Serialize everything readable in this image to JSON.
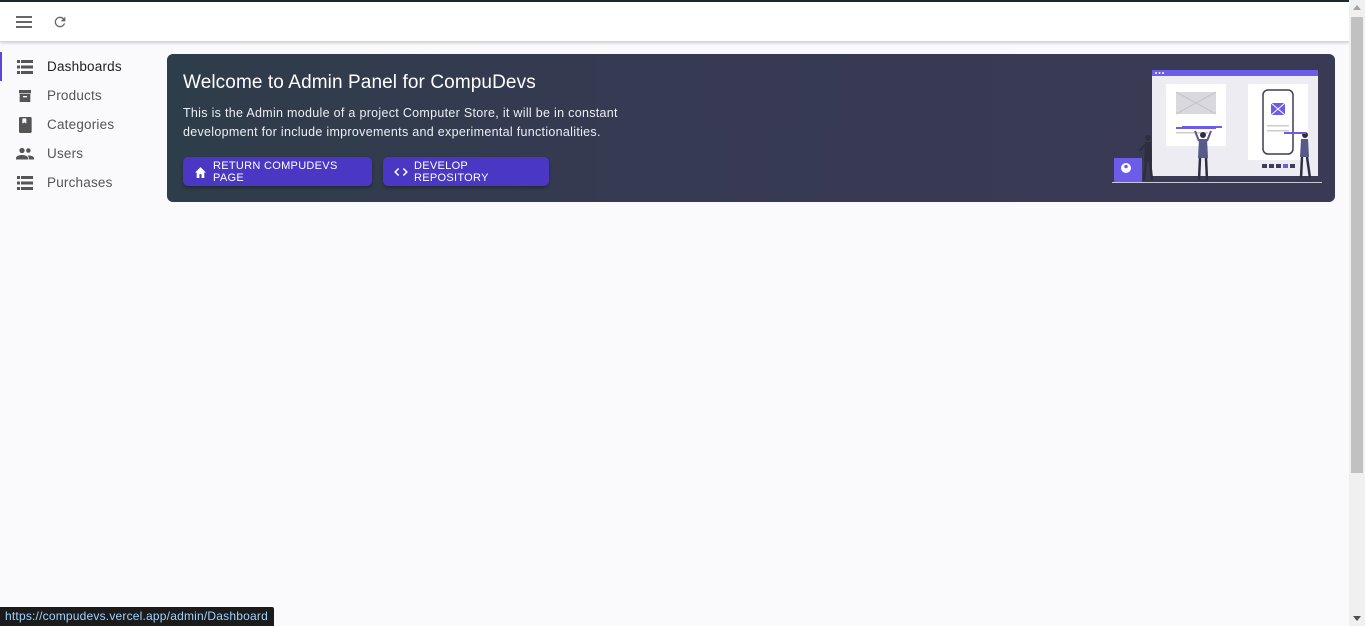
{
  "appbar": {
    "menu_icon": "hamburger-menu-icon",
    "refresh_icon": "refresh-icon"
  },
  "sidebar": {
    "items": [
      {
        "label": "Dashboards",
        "icon": "list-icon",
        "active": true
      },
      {
        "label": "Products",
        "icon": "archive-box-icon"
      },
      {
        "label": "Categories",
        "icon": "book-icon"
      },
      {
        "label": "Users",
        "icon": "people-icon"
      },
      {
        "label": "Purchases",
        "icon": "list-icon"
      }
    ]
  },
  "banner": {
    "title": "Welcome to Admin Panel for CompuDevs",
    "description": "This is the Admin module of a project Computer Store, it will be in constant development for include improvements and experimental functionalities.",
    "buttons": {
      "home_label": "RETURN COMPUDEVS PAGE",
      "repo_label": "DEVELOP REPOSITORY"
    }
  },
  "status_url": "https://compudevs.vercel.app/admin/Dashboard",
  "colors": {
    "accent": "#4a38c5",
    "banner_bg": "#363a52",
    "active_indicator": "#5a47d6"
  }
}
